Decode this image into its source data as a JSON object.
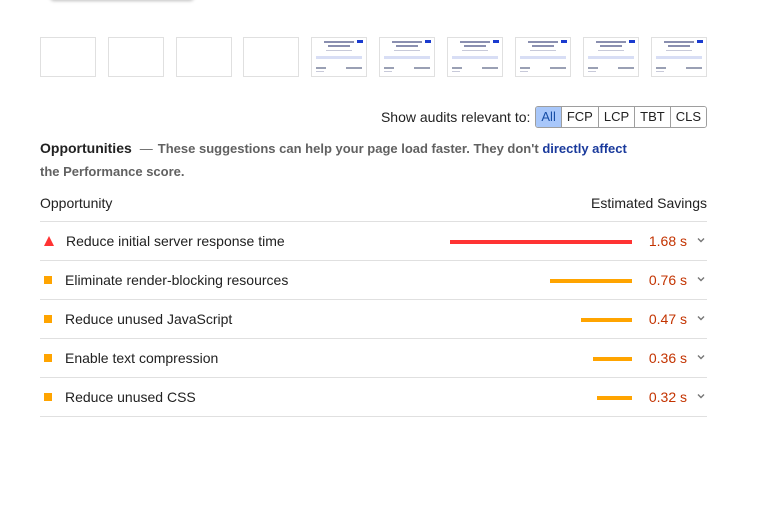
{
  "filter": {
    "label": "Show audits relevant to:",
    "buttons": [
      "All",
      "FCP",
      "LCP",
      "TBT",
      "CLS"
    ],
    "active": "All"
  },
  "opportunities": {
    "title": "Opportunities",
    "dash": "—",
    "desc_before": "These suggestions can help your page load faster. They don't",
    "link_text": "directly affect",
    "desc_after": "the Performance score."
  },
  "table": {
    "col_opportunity": "Opportunity",
    "col_savings": "Estimated Savings",
    "rows": [
      {
        "label": "Reduce initial server response time",
        "savings": "1.68 s",
        "seconds": 1.68,
        "status": "fail"
      },
      {
        "label": "Eliminate render-blocking resources",
        "savings": "0.76 s",
        "seconds": 0.76,
        "status": "average"
      },
      {
        "label": "Reduce unused JavaScript",
        "savings": "0.47 s",
        "seconds": 0.47,
        "status": "average"
      },
      {
        "label": "Enable text compression",
        "savings": "0.36 s",
        "seconds": 0.36,
        "status": "average"
      },
      {
        "label": "Reduce unused CSS",
        "savings": "0.32 s",
        "seconds": 0.32,
        "status": "average"
      }
    ]
  },
  "colors": {
    "fail": "#ff3333",
    "average": "#ffa400",
    "savings_text": "#c33300",
    "active_filter_bg": "#a8c7fa",
    "link": "#1a3a9c"
  },
  "icons": {
    "fail": "triangle-warning-icon",
    "average": "square-average-icon",
    "expand": "chevron-down-icon"
  }
}
